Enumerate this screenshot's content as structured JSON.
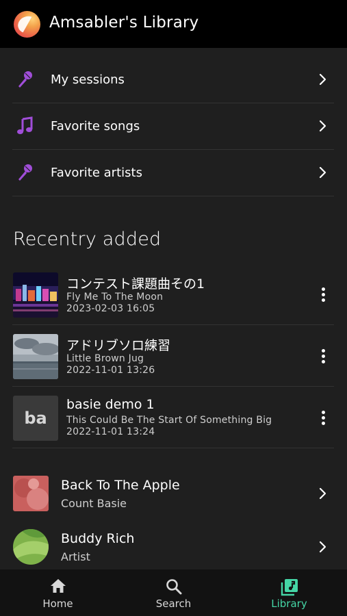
{
  "header": {
    "title": "Amsabler's Library"
  },
  "nav": [
    {
      "label": "My sessions",
      "icon": "microphone-icon"
    },
    {
      "label": "Favorite songs",
      "icon": "music-note-icon"
    },
    {
      "label": "Favorite artists",
      "icon": "microphone-icon"
    }
  ],
  "recent": {
    "title": "Recentry added",
    "items": [
      {
        "title": "コンテスト課題曲その1",
        "song": "Fly Me To The Moon",
        "date": "2023-02-03 16:05",
        "thumb": "night-city-photo"
      },
      {
        "title": "アドリブソロ練習",
        "song": "Little Brown Jug",
        "date": "2022-11-01 13:26",
        "thumb": "cloudy-sea-photo"
      },
      {
        "title": "basie demo 1",
        "song": "This Could Be The Start Of Something Big",
        "date": "2022-11-01 13:24",
        "thumb_text": "ba"
      }
    ]
  },
  "items": [
    {
      "title": "Back To The Apple",
      "sub": "Count Basie",
      "thumb": "album-art"
    },
    {
      "title": "Buddy Rich",
      "sub": "Artist",
      "thumb": "artist-avatar"
    }
  ],
  "tabs": [
    {
      "label": "Home",
      "icon": "home-icon"
    },
    {
      "label": "Search",
      "icon": "search-icon"
    },
    {
      "label": "Library",
      "icon": "library-icon"
    }
  ],
  "colors": {
    "accent": "#45d6a6",
    "icon_purple": "#a04ed8",
    "background": "#1f1f1f",
    "header": "#000000"
  }
}
